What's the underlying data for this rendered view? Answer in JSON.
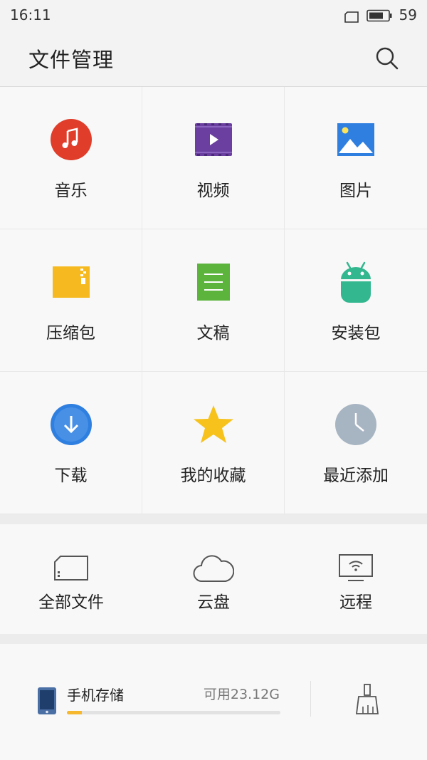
{
  "status_bar": {
    "time": "16:11",
    "battery_level": "59"
  },
  "app_bar": {
    "title": "文件管理",
    "search_icon": "search-icon"
  },
  "categories": [
    {
      "label": "音乐",
      "icon": "music-icon",
      "color": "#e03d2a"
    },
    {
      "label": "视频",
      "icon": "video-icon",
      "color": "#6a3fa0"
    },
    {
      "label": "图片",
      "icon": "picture-icon",
      "color": "#2f7fe0"
    },
    {
      "label": "压缩包",
      "icon": "archive-icon",
      "color": "#f6b91f"
    },
    {
      "label": "文稿",
      "icon": "document-icon",
      "color": "#5cb43d"
    },
    {
      "label": "安装包",
      "icon": "android-icon",
      "color": "#33b78f"
    },
    {
      "label": "下载",
      "icon": "download-icon",
      "color": "#2f7fe0"
    },
    {
      "label": "我的收藏",
      "icon": "star-icon",
      "color": "#f6c21b"
    },
    {
      "label": "最近添加",
      "icon": "clock-icon",
      "color": "#a7b4c2"
    }
  ],
  "quick_actions": [
    {
      "label": "全部文件",
      "icon": "storage-card-icon"
    },
    {
      "label": "云盘",
      "icon": "cloud-icon"
    },
    {
      "label": "远程",
      "icon": "remote-monitor-icon"
    }
  ],
  "storage": {
    "name": "手机存储",
    "available": "可用23.12G",
    "used_fraction": 0.07,
    "phone_icon": "phone-icon",
    "clean_icon": "broom-icon"
  }
}
